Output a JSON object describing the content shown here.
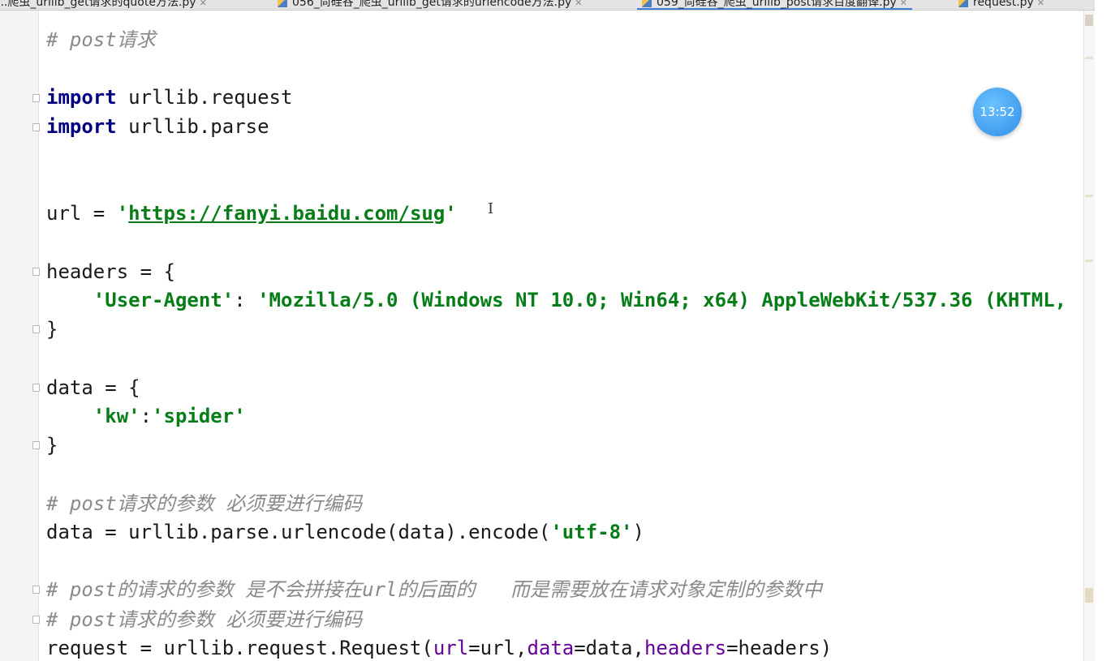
{
  "tabs": [
    {
      "label": "...爬虫_urllib_get请求的quote方法.py",
      "active": false
    },
    {
      "label": "056_尚硅谷_爬虫_urllib_get请求的urlencode方法.py",
      "active": false
    },
    {
      "label": "059_尚硅谷_爬虫_urllib_post请求百度翻译.py",
      "active": true
    },
    {
      "label": "request.py",
      "active": false
    }
  ],
  "editor": {
    "comment_post": "# post请求",
    "kw_import": "import",
    "import_request_rest": " urllib.request",
    "import_parse_rest": " urllib.parse",
    "url_prefix": "url = ",
    "url_quote": "'",
    "url_value": "https://fanyi.baidu.com/sug",
    "headers_open": "headers = {",
    "ua_indent": "    ",
    "ua_key": "'User-Agent'",
    "ua_colon": ": ",
    "ua_value": "'Mozilla/5.0 (Windows NT 10.0; Win64; x64) AppleWebKit/537.36 (KHTML,",
    "brace_close": "}",
    "data_open": "data = {",
    "data_kw_key": "'kw'",
    "data_colon": ":",
    "data_kw_value": "'spider'",
    "comment_encode": "# post请求的参数 必须要进行编码",
    "encode_prefix": "data = urllib.parse.urlencode(data).encode(",
    "encode_arg": "'utf-8'",
    "encode_suffix": ")",
    "comment_url_note": "# post的请求的参数 是不会拼接在url的后面的   而是需要放在请求对象定制的参数中",
    "comment_encode2": "# post请求的参数 必须要进行编码",
    "request_prefix": "request = urllib.request.Request(",
    "param_url": "url",
    "eq_url": "=url,",
    "param_data": "data",
    "eq_data": "=data,",
    "param_headers": "headers",
    "eq_headers": "=headers)"
  },
  "overlay": {
    "timer": "13:52"
  },
  "colors": {
    "keyword": "#000080",
    "string": "#067d17",
    "comment": "#8a8a8a",
    "param": "#660099",
    "timer_badge": "#2f8fe8"
  }
}
